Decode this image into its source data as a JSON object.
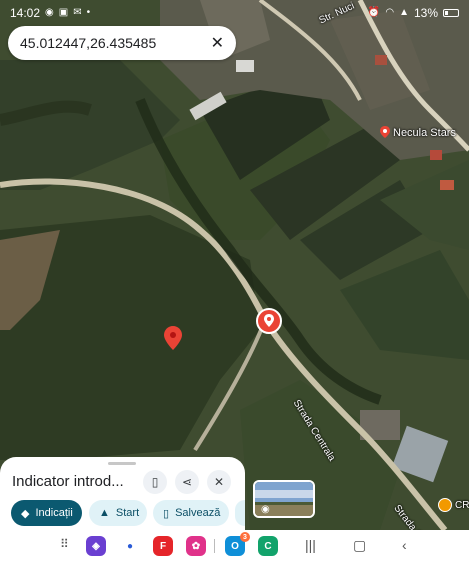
{
  "status_bar": {
    "time": "14:02",
    "battery": "13%",
    "icons_left": [
      "messenger-icon",
      "outlook-icon",
      "gmail-icon",
      "dot-icon"
    ],
    "icons_right": [
      "alarm-icon",
      "wifi-icon",
      "signal-icon",
      "battery-icon"
    ]
  },
  "search": {
    "query": "45.012447,26.435485"
  },
  "map": {
    "labels": {
      "street_nuci": "Str. Nuci",
      "necula": "Necula Stars",
      "strada_centrala": "Strada Centrala",
      "strada_c": "Strada C",
      "poi_cr": "CR"
    },
    "colors": {
      "field_dark": "#2f3a24",
      "field_green": "#4a5a34",
      "road": "#c9c2a8",
      "pin_red": "#ea4335"
    }
  },
  "sheet": {
    "title": "Indicator introd...",
    "actions": {
      "directions": "Indicații",
      "start": "Start",
      "save": "Salvează"
    }
  },
  "nav": {
    "apps": [
      "apps-grid-icon",
      "browser-icon",
      "messages-icon",
      "flipboard-icon",
      "flower-icon",
      "outlook-icon",
      "phone-icon"
    ],
    "outlook_badge": "3"
  }
}
